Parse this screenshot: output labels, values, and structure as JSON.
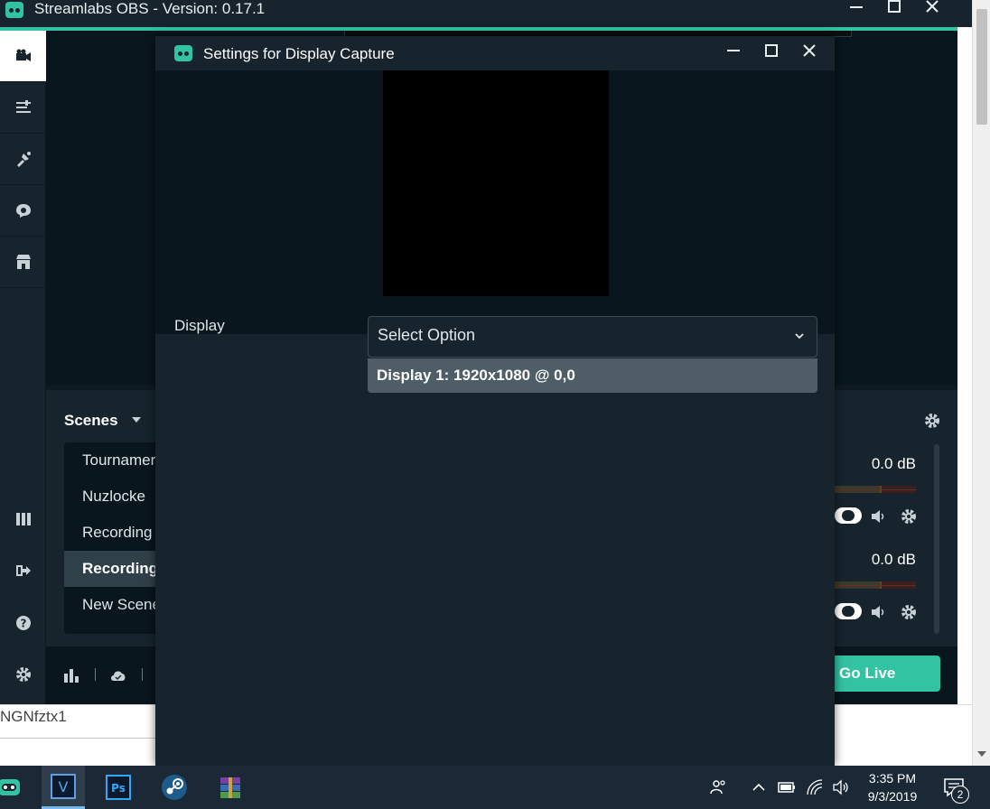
{
  "app": {
    "title": "Streamlabs OBS - Version: 0.17.1",
    "accent_color": "#31c3a2",
    "background_color": "#17242d"
  },
  "window_controls": [
    "minimize-icon",
    "maximize-icon",
    "close-icon"
  ],
  "sidebar": {
    "top_items": [
      "camera-icon",
      "sliders-icon",
      "theme-icon",
      "chat-icon",
      "store-icon"
    ],
    "bottom_items": [
      "studio-mode-icon",
      "logout-icon",
      "help-icon",
      "settings-icon"
    ]
  },
  "scenes": {
    "label": "Scenes",
    "items": [
      "Tournamer",
      "Nuzlocke",
      "Recording",
      "Recording",
      "New Scene"
    ],
    "selected_index": 3
  },
  "mixer": {
    "channels": [
      {
        "level": "0.0 dB"
      },
      {
        "level": "0.0 dB"
      }
    ]
  },
  "footer": {
    "go_live_label": "Go Live"
  },
  "behind_text": "NGNfztx1",
  "dialog": {
    "title": "Settings for Display Capture",
    "display_label": "Display",
    "select": {
      "placeholder": "Select Option",
      "options": [
        "Display 1: 1920x1080 @ 0,0"
      ]
    }
  },
  "taskbar": {
    "apps": [
      "streamlabs-icon",
      "v-editor-icon",
      "photoshop-icon",
      "steam-icon",
      "winrar-icon"
    ],
    "ps_label": "Ps",
    "v_label": "V",
    "time": "3:35 PM",
    "date": "9/3/2019",
    "notification_count": "2"
  }
}
